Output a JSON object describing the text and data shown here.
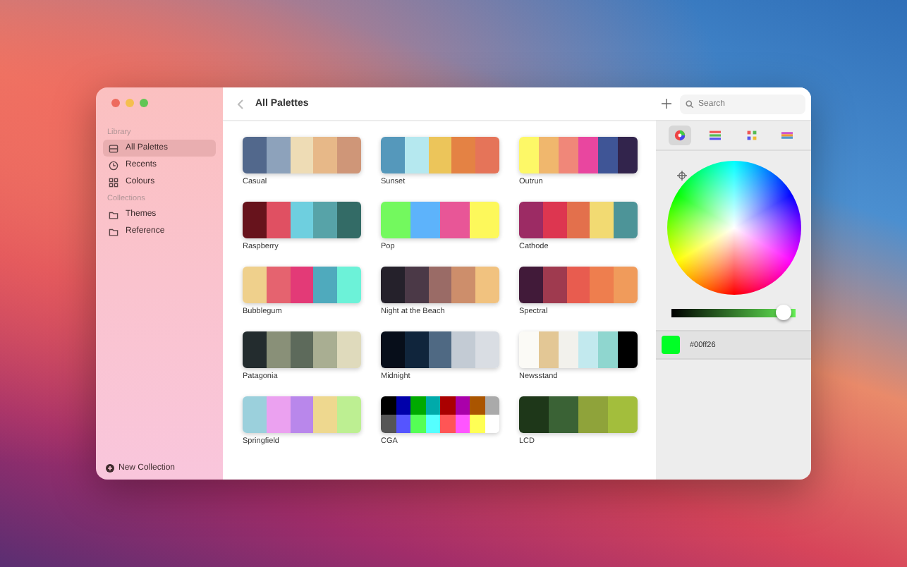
{
  "window": {
    "title": "All Palettes"
  },
  "sidebar": {
    "sections": [
      {
        "heading": "Library",
        "items": [
          {
            "label": "All Palettes",
            "selected": true
          },
          {
            "label": "Recents",
            "selected": false
          },
          {
            "label": "Colours",
            "selected": false
          }
        ]
      },
      {
        "heading": "Collections",
        "items": [
          {
            "label": "Themes",
            "selected": false
          },
          {
            "label": "Reference",
            "selected": false
          }
        ]
      }
    ],
    "new_collection": "New Collection"
  },
  "palettes": [
    {
      "name": "Casual",
      "swatches": [
        {
          "color": "#52688c"
        },
        {
          "color": "#8da2bb"
        },
        {
          "color": "#eedcb5"
        },
        {
          "color": "#e7b888"
        },
        {
          "color": "#cf9678"
        }
      ]
    },
    {
      "name": "Sunset",
      "swatches": [
        {
          "color": "#5598bb"
        },
        {
          "color": "#b5e8ef"
        },
        {
          "color": "#ecc55a"
        },
        {
          "color": "#e48244"
        },
        {
          "color": "#e57459"
        }
      ]
    },
    {
      "name": "Outrun",
      "swatches": [
        {
          "color": "#fdf867"
        },
        {
          "color": "#f0b76d"
        },
        {
          "color": "#f08779"
        },
        {
          "color": "#e9469f"
        },
        {
          "color": "#3f5596"
        },
        {
          "color": "#32244c"
        }
      ]
    },
    {
      "name": "Raspberry",
      "swatches": [
        {
          "color": "#67131c"
        },
        {
          "color": "#e05062"
        },
        {
          "color": "#6ecfdf"
        },
        {
          "color": "#57a3a8"
        },
        {
          "color": "#336b66"
        }
      ]
    },
    {
      "name": "Pop",
      "swatches": [
        {
          "color": "#73f95e"
        },
        {
          "color": "#5db3fb"
        },
        {
          "color": "#e85697"
        },
        {
          "color": "#fdf85b"
        }
      ]
    },
    {
      "name": "Cathode",
      "swatches": [
        {
          "color": "#9c2b64"
        },
        {
          "color": "#dd3650"
        },
        {
          "color": "#e3704c"
        },
        {
          "color": "#f2da72"
        },
        {
          "color": "#4d9498"
        }
      ]
    },
    {
      "name": "Bubblegum",
      "swatches": [
        {
          "color": "#efd08c"
        },
        {
          "color": "#e5636f"
        },
        {
          "color": "#e33a77"
        },
        {
          "color": "#4faabd"
        },
        {
          "color": "#6cf2d8"
        }
      ]
    },
    {
      "name": "Night at the Beach",
      "swatches": [
        {
          "color": "#25212b"
        },
        {
          "color": "#4b3947"
        },
        {
          "color": "#9a6b66"
        },
        {
          "color": "#cd8e6b"
        },
        {
          "color": "#f1c27f"
        }
      ]
    },
    {
      "name": "Spectral",
      "swatches": [
        {
          "color": "#411a39"
        },
        {
          "color": "#9f3a4f"
        },
        {
          "color": "#e85c4f"
        },
        {
          "color": "#ee7e4e"
        },
        {
          "color": "#f09b5b"
        }
      ]
    },
    {
      "name": "Patagonia",
      "swatches": [
        {
          "color": "#232c2e"
        },
        {
          "color": "#899078"
        },
        {
          "color": "#5d6a5b"
        },
        {
          "color": "#a9ae92"
        },
        {
          "color": "#dfdabc"
        }
      ]
    },
    {
      "name": "Midnight",
      "swatches": [
        {
          "color": "#070e1a"
        },
        {
          "color": "#10253c"
        },
        {
          "color": "#4f6983"
        },
        {
          "color": "#c3cbd4"
        },
        {
          "color": "#d9dde3"
        }
      ]
    },
    {
      "name": "Newsstand",
      "swatches": [
        {
          "color": "#fbfaf6"
        },
        {
          "color": "#e3c795"
        },
        {
          "color": "#f2f1ec"
        },
        {
          "color": "#c2e9ee"
        },
        {
          "color": "#8fd6cf"
        },
        {
          "color": "#000000"
        }
      ]
    },
    {
      "name": "Springfield",
      "swatches": [
        {
          "color": "#9bd0dc"
        },
        {
          "color": "#eba1f0"
        },
        {
          "color": "#b987eb"
        },
        {
          "color": "#eed88f"
        },
        {
          "color": "#bdef92"
        }
      ]
    },
    {
      "name": "CGA",
      "swatches": [
        {
          "color": "#000000"
        },
        {
          "color": "#0000aa"
        },
        {
          "color": "#00aa00"
        },
        {
          "color": "#00aaaa"
        },
        {
          "color": "#aa0000"
        },
        {
          "color": "#aa00aa"
        },
        {
          "color": "#aa5500"
        },
        {
          "color": "#aaaaaa"
        },
        {
          "color": "#555555"
        },
        {
          "color": "#5555ff"
        },
        {
          "color": "#55ff55"
        },
        {
          "color": "#55ffff"
        },
        {
          "color": "#ff5555"
        },
        {
          "color": "#ff55ff"
        },
        {
          "color": "#ffff55"
        },
        {
          "color": "#ffffff"
        }
      ]
    },
    {
      "name": "LCD",
      "swatches": [
        {
          "color": "#1e3719"
        },
        {
          "color": "#3a6235"
        },
        {
          "color": "#8fa33a"
        },
        {
          "color": "#a3be3c"
        }
      ]
    }
  ],
  "search": {
    "placeholder": "Search"
  },
  "picker": {
    "modes": [
      {
        "selected": true
      },
      {
        "selected": false
      },
      {
        "selected": false
      },
      {
        "selected": false
      }
    ],
    "brightness": {
      "level": 0.96
    },
    "color": "#00ff26",
    "hex": "#00ff26"
  }
}
